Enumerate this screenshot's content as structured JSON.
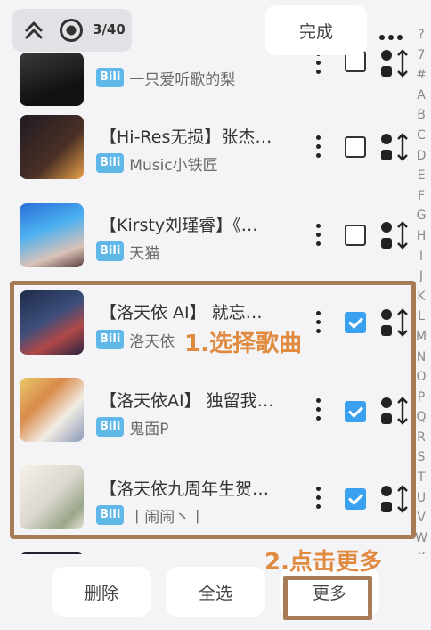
{
  "topbar": {
    "counter": "3/40",
    "done_label": "完成"
  },
  "songs": [
    {
      "title": "",
      "bili": "Bili",
      "uploader": "一只爱听歌的梨",
      "checked": false
    },
    {
      "title": "【Hi-Res无损】张杰…",
      "bili": "Bili",
      "uploader": "Music小铁匠",
      "checked": false
    },
    {
      "title": "【Kirsty刘瑾睿】《…",
      "bili": "Bili",
      "uploader": "天猫",
      "checked": false
    },
    {
      "title": "【洛天依 AI】 就忘…",
      "bili": "Bili",
      "uploader": "洛天依",
      "checked": true
    },
    {
      "title": "【洛天依AI】 独留我…",
      "bili": "Bili",
      "uploader": "鬼面P",
      "checked": true
    },
    {
      "title": "【洛天依九周年生贺…",
      "bili": "Bili",
      "uploader": "丨闹闹丶丨",
      "checked": true
    }
  ],
  "alphabet": [
    "?",
    "7",
    "#",
    "A",
    "B",
    "C",
    "D",
    "E",
    "F",
    "G",
    "H",
    "I",
    "J",
    "K",
    "L",
    "M",
    "N",
    "O",
    "P",
    "Q",
    "R",
    "S",
    "T",
    "U",
    "V",
    "W",
    "X",
    "Y",
    "Z"
  ],
  "annotations": {
    "step1": "1.选择歌曲",
    "step2": "2.点击更多"
  },
  "bottom": {
    "delete_label": "删除",
    "select_all_label": "全选",
    "more_label": "更多"
  },
  "colors": {
    "accent": "#3aa0f0",
    "bili": "#5fb8e8",
    "annotation": "#e08a40",
    "highlight": "#a77b55"
  }
}
